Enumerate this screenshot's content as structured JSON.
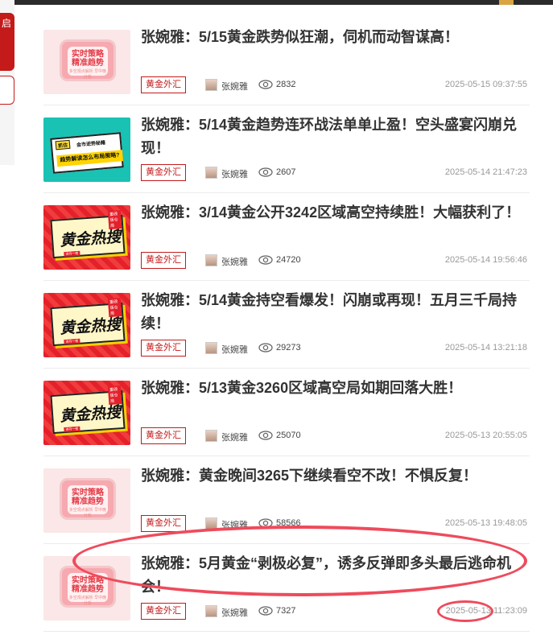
{
  "left": {
    "side_text": "启"
  },
  "articles": [
    {
      "title": "张婉雅：5/15黄金跌势似狂潮，伺机而动智谋高！",
      "tag": "黄金外汇",
      "author": "张婉雅",
      "views": "2832",
      "time": "2025-05-15 09:37:55",
      "thumb": "pink",
      "thumb_text1": "实时策略",
      "thumb_text2": "精准趋势",
      "thumb_sub": "多空观点解析 早中晚分析"
    },
    {
      "title": "张婉雅：5/14黄金趋势连环战法单单止盈！空头盛宴闪崩兑现！",
      "tag": "黄金外汇",
      "author": "张婉雅",
      "views": "2607",
      "time": "2025-05-14 21:47:23",
      "thumb": "teal",
      "thumb_text1": "金市逆势秘籍",
      "thumb_text2": "趋势解读怎么布局策略?",
      "thumb_corner": "抓住"
    },
    {
      "title": "张婉雅：3/14黄金公开3242区域高空持续胜！大幅获利了！",
      "tag": "黄金外汇",
      "author": "张婉雅",
      "views": "24720",
      "time": "2025-05-14 19:56:46",
      "thumb": "red",
      "thumb_text1": "黄金热搜",
      "thumb_badge": "重磅版仓局",
      "thumb_small": "讲丹一看"
    },
    {
      "title": "张婉雅：5/14黄金持空看爆发！闪崩或再现！五月三千局持续！",
      "tag": "黄金外汇",
      "author": "张婉雅",
      "views": "29273",
      "time": "2025-05-14 13:21:18",
      "thumb": "red",
      "thumb_text1": "黄金热搜",
      "thumb_badge": "重磅版仓局",
      "thumb_small": "讲丹一看"
    },
    {
      "title": "张婉雅：5/13黄金3260区域高空局如期回落大胜！",
      "tag": "黄金外汇",
      "author": "张婉雅",
      "views": "25070",
      "time": "2025-05-13 20:55:05",
      "thumb": "red",
      "thumb_text1": "黄金热搜",
      "thumb_badge": "重磅版仓局",
      "thumb_small": "讲丹一看"
    },
    {
      "title": "张婉雅：黄金晚间3265下继续看空不改！不惧反复！",
      "tag": "黄金外汇",
      "author": "张婉雅",
      "views": "58566",
      "time": "2025-05-13 19:48:05",
      "thumb": "pink",
      "thumb_text1": "实时策略",
      "thumb_text2": "精准趋势",
      "thumb_sub": "多空观点解析 早中晚分析"
    },
    {
      "title": "张婉雅：5月黄金“剥极必复”，诱多反弹即多头最后逃命机会！",
      "tag": "黄金外汇",
      "author": "张婉雅",
      "views": "7327",
      "time": "2025-05-13 11:23:09",
      "thumb": "pink",
      "thumb_text1": "实时策略",
      "thumb_text2": "精准趋势",
      "thumb_sub": "多空观点解析 早中晚分析"
    }
  ],
  "annotation_color": "#ee4b5c",
  "accent": "#c41a1a"
}
